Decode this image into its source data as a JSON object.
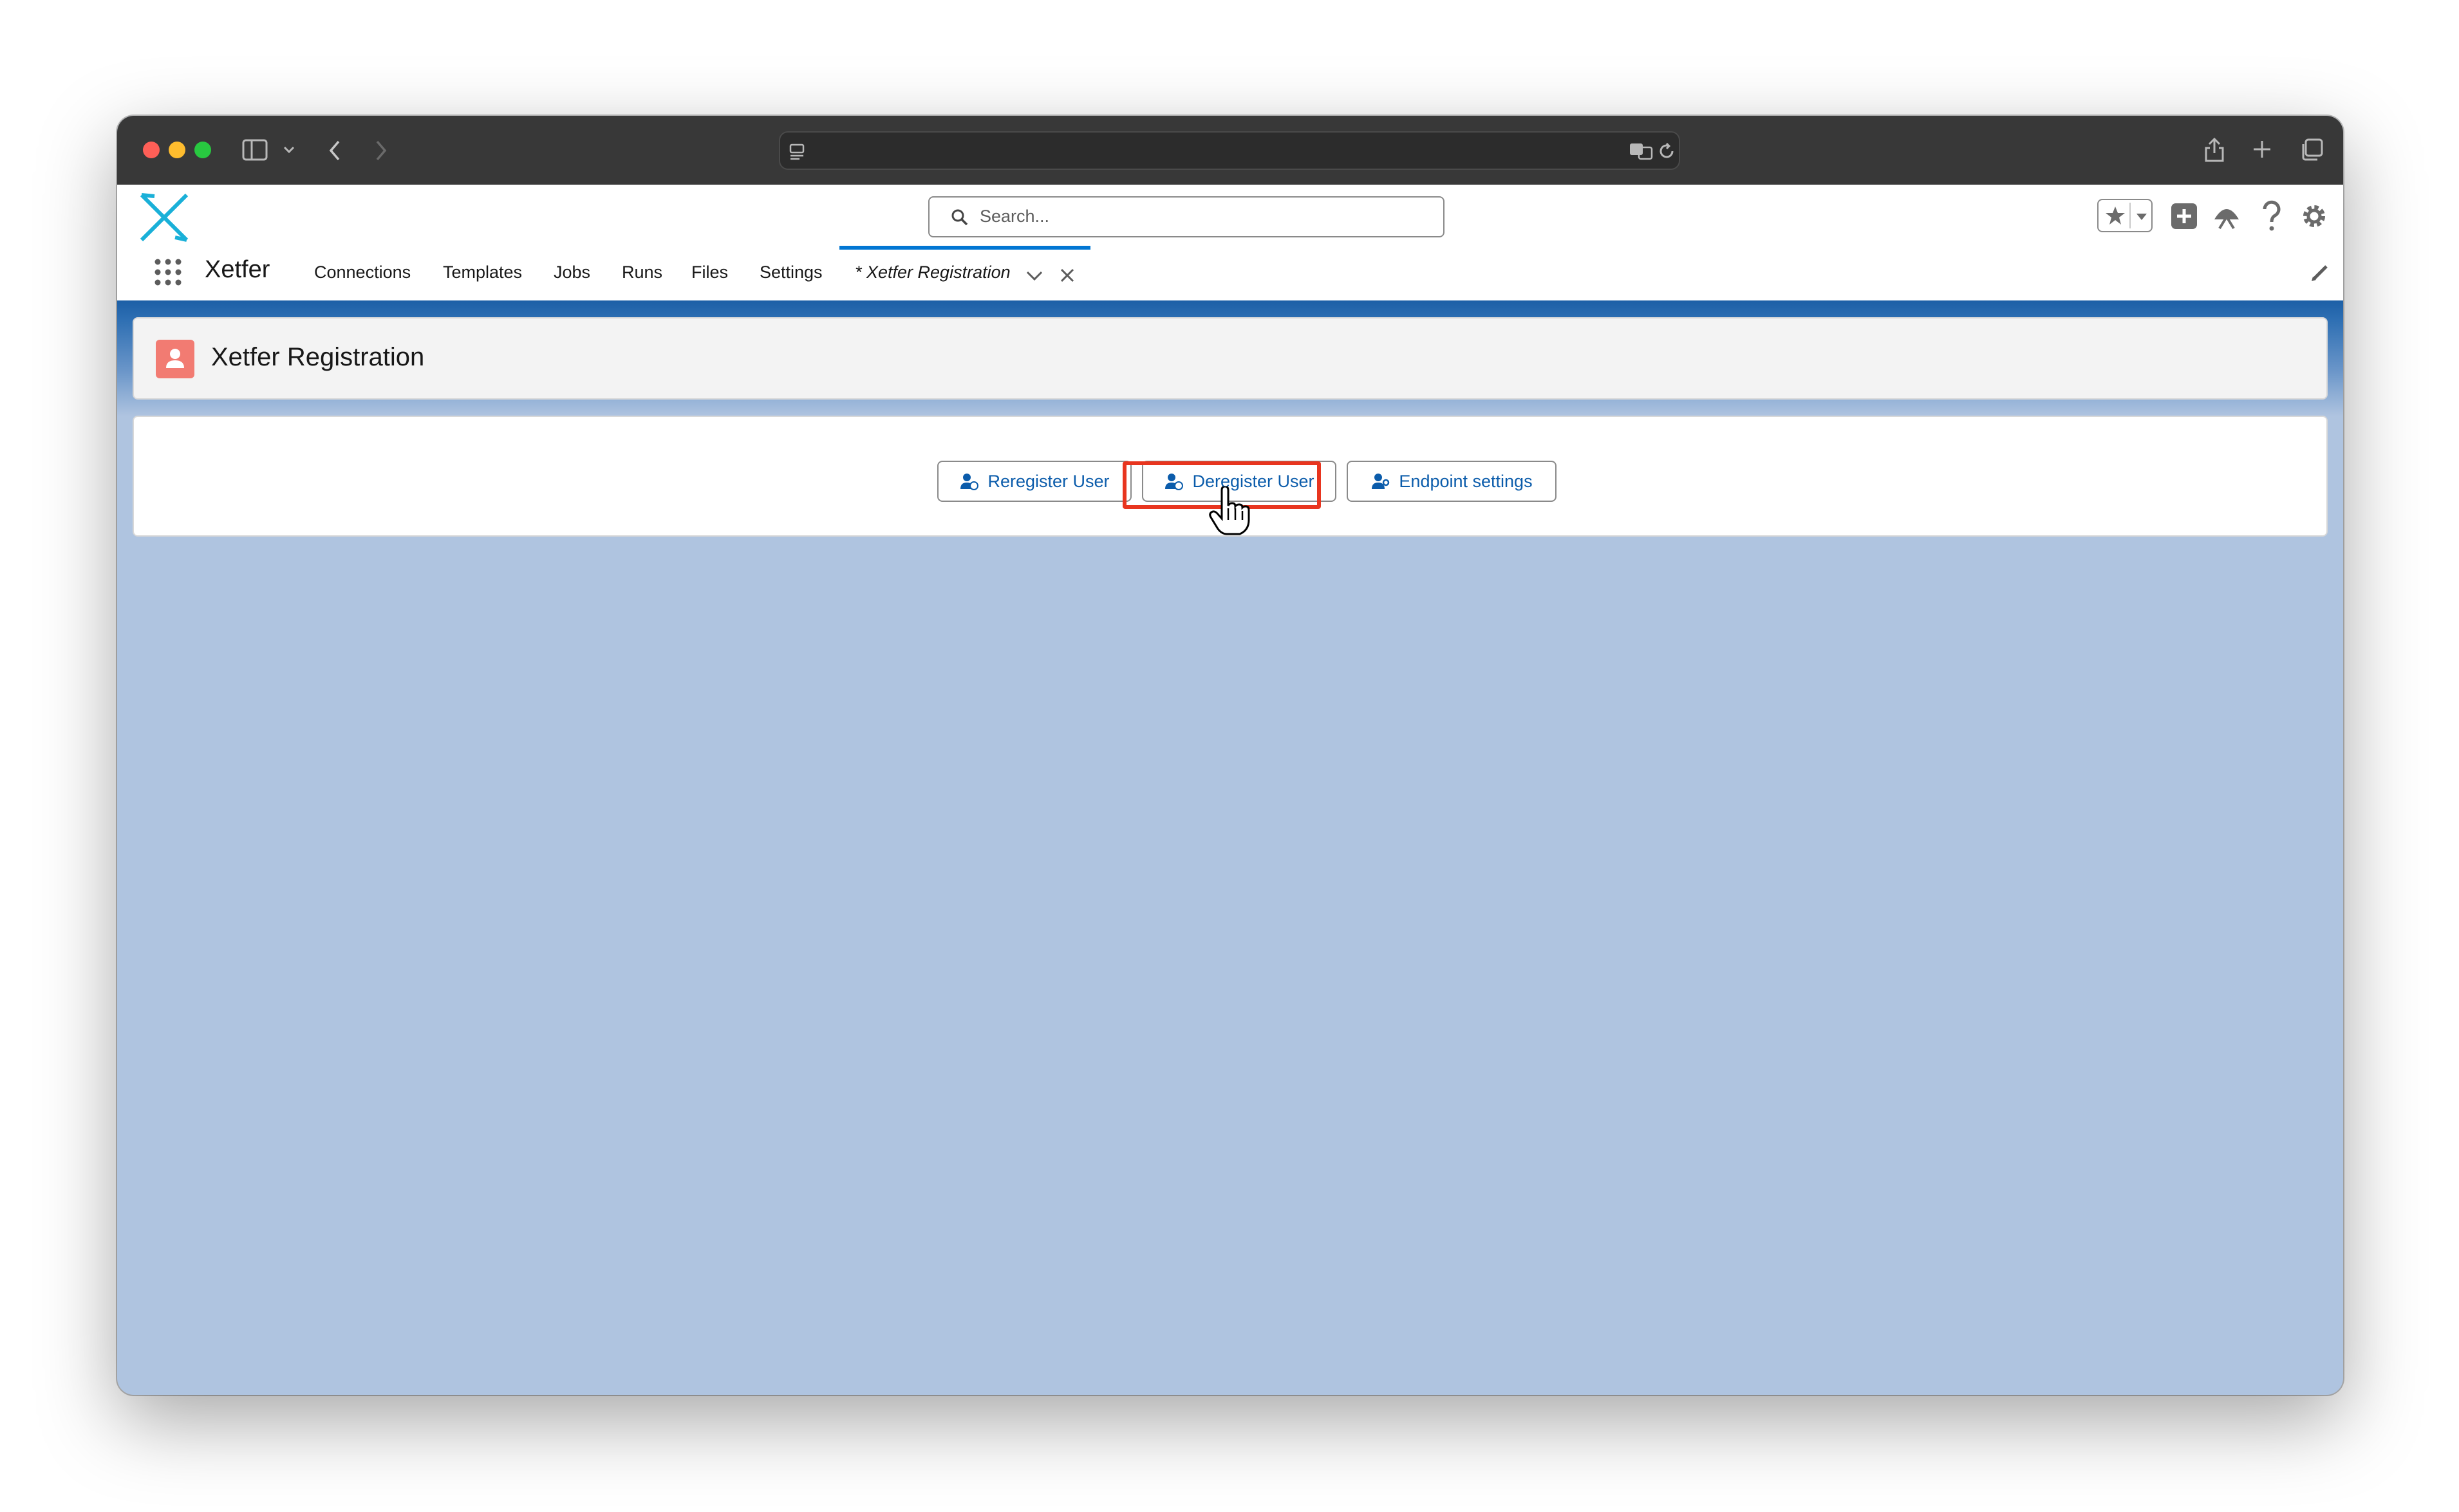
{
  "browser": {
    "address": ""
  },
  "app": {
    "name": "Xetfer",
    "search_placeholder": "Search...",
    "nav": [
      "Connections",
      "Templates",
      "Jobs",
      "Runs",
      "Files",
      "Settings"
    ],
    "active_tab": "* Xetfer Registration"
  },
  "page": {
    "title": "Xetfer Registration",
    "buttons": {
      "reregister": "Reregister User",
      "deregister": "Deregister User",
      "endpoint": "Endpoint settings"
    }
  },
  "colors": {
    "accent": "#0176d3",
    "button_text": "#0b5cab",
    "page_icon": "#f27b72",
    "highlight": "#e8351f",
    "background": "#afc4e0"
  },
  "icons": [
    "sidebar-icon",
    "back-icon",
    "forward-icon",
    "translate-icon",
    "reload-icon",
    "share-icon",
    "new-tab-icon",
    "tabs-overview-icon",
    "favorites-icon",
    "add-icon",
    "trailhead-icon",
    "help-icon",
    "gear-icon",
    "bell-icon",
    "avatar",
    "edit-icon"
  ]
}
